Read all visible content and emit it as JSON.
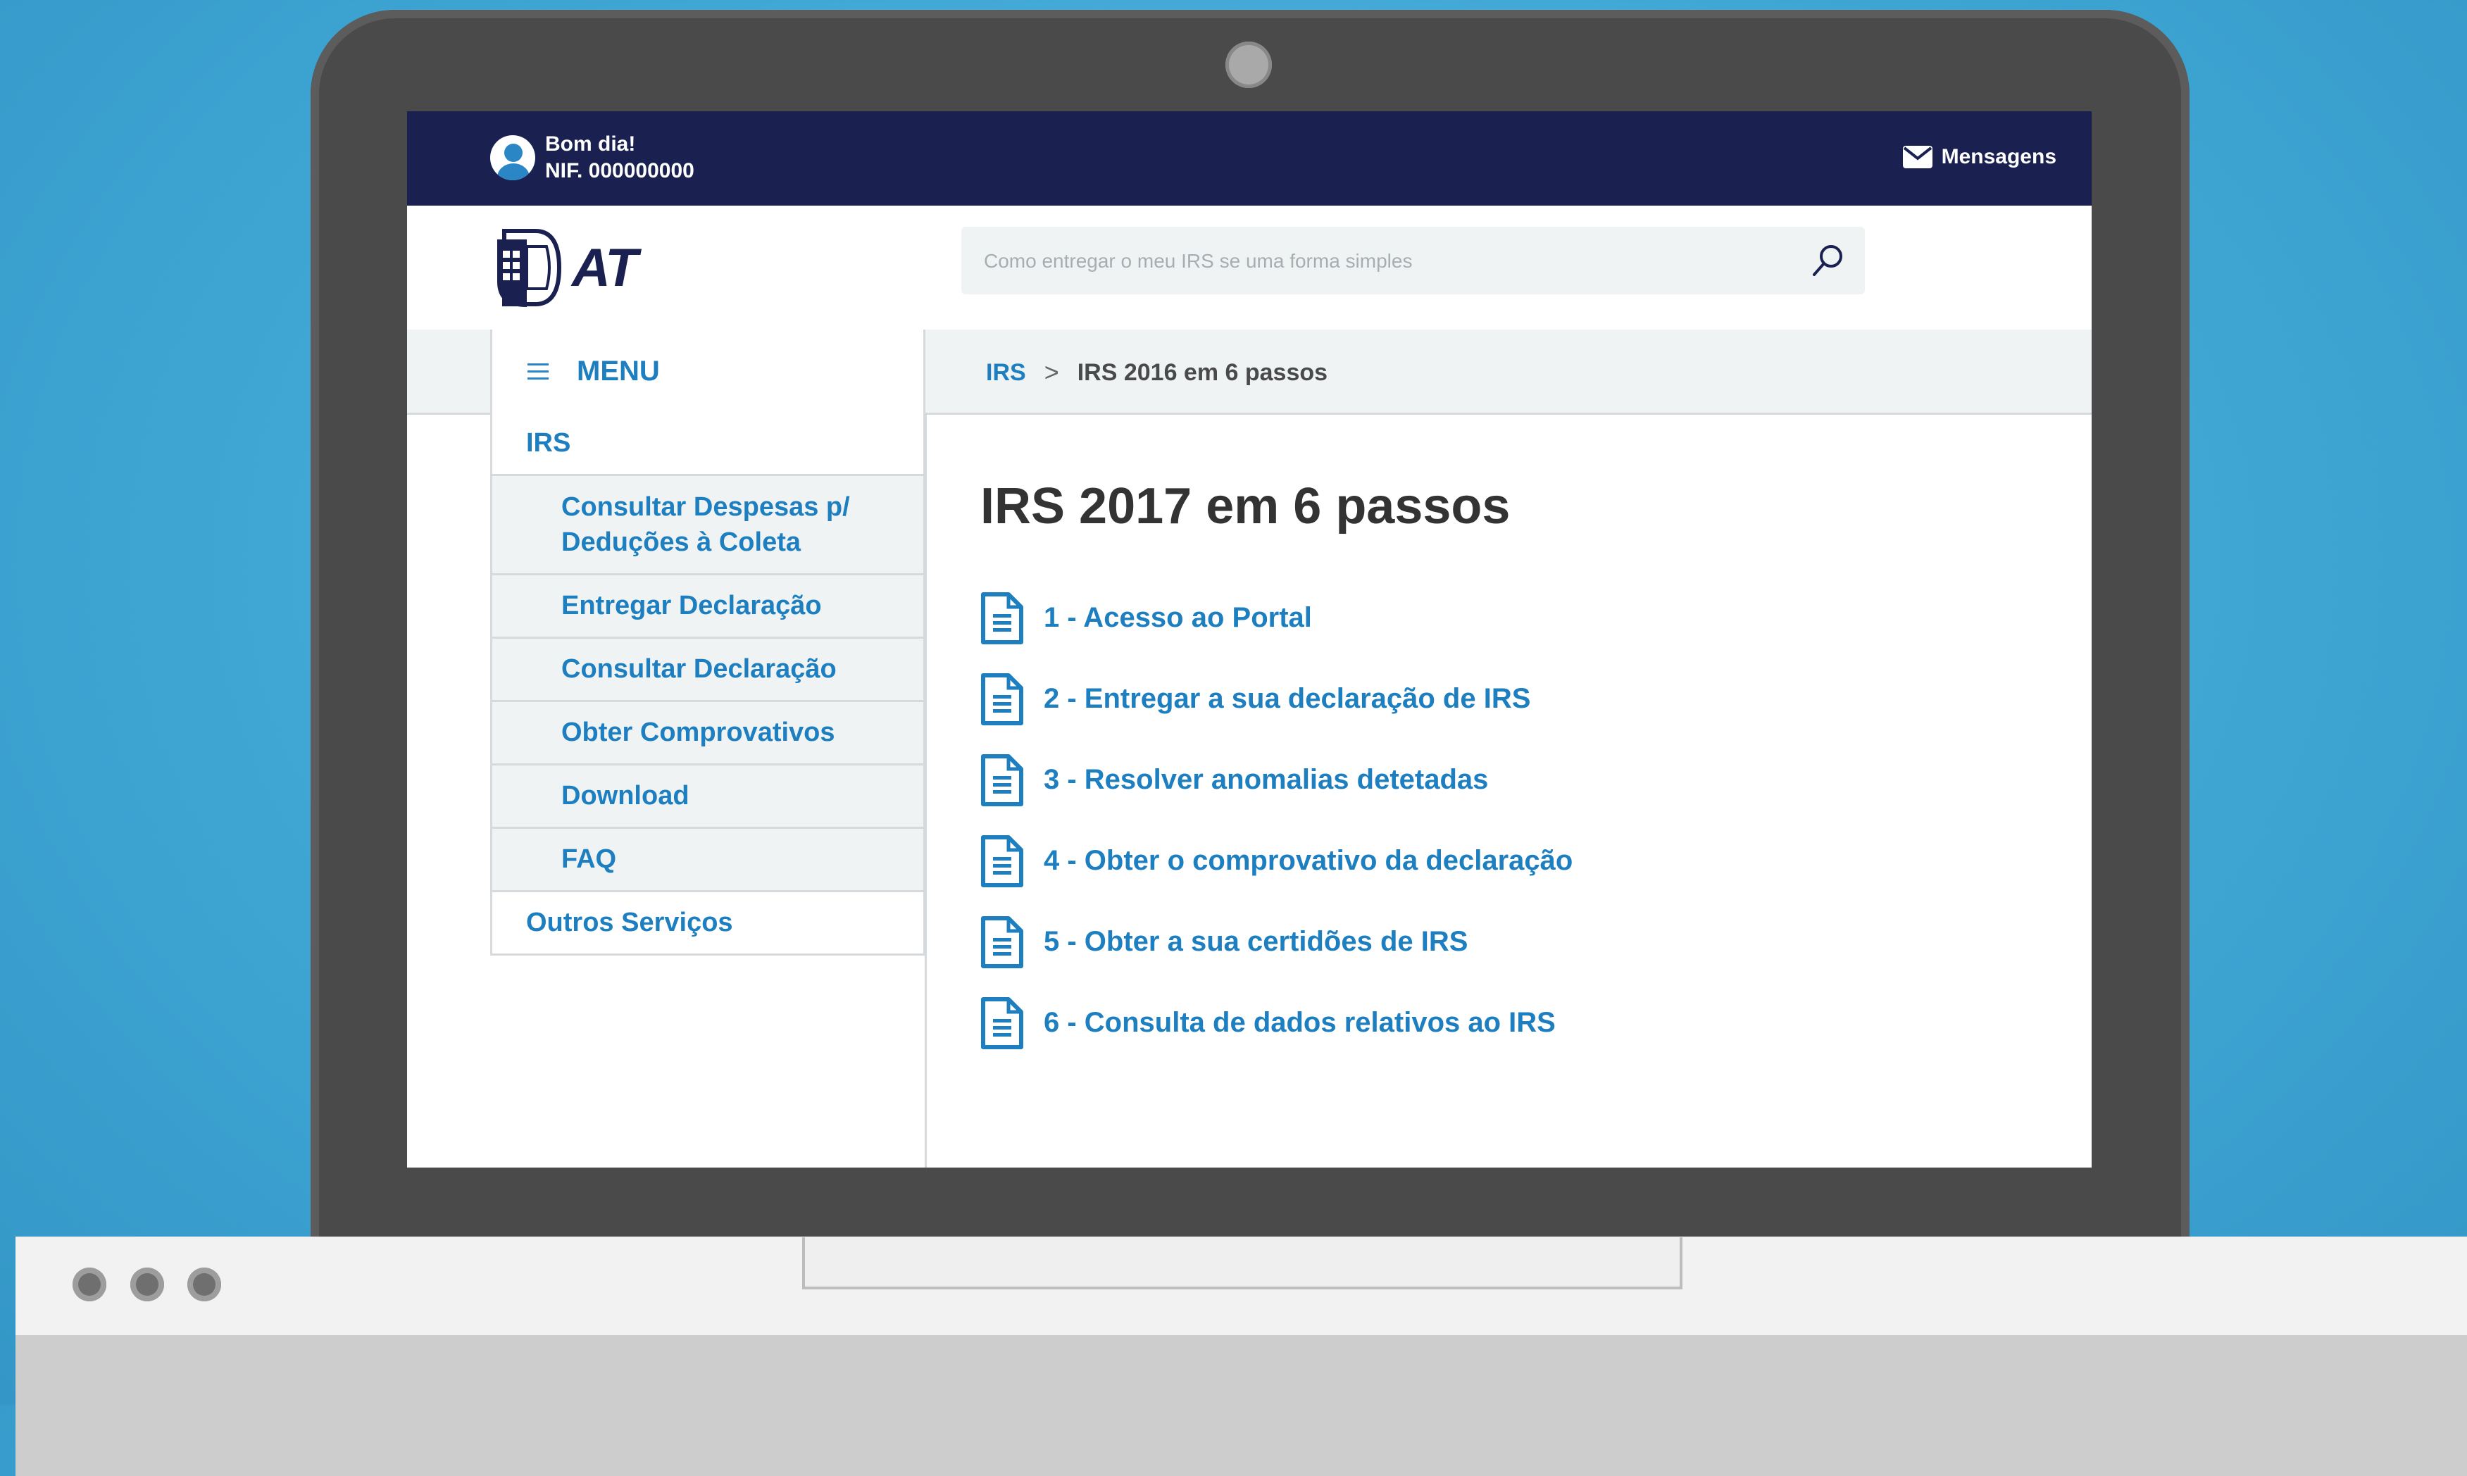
{
  "header": {
    "greeting": "Bom dia!",
    "nif": "NIF. 000000000",
    "messages_label": "Mensagens",
    "logo_text": "AT"
  },
  "search": {
    "placeholder": "Como entregar o meu IRS se uma forma simples"
  },
  "menu": {
    "label": "MENU"
  },
  "breadcrumb": {
    "items": [
      "IRS",
      "IRS 2016 em 6 passos"
    ],
    "separator": ">"
  },
  "sidebar": {
    "items": [
      {
        "label": "IRS",
        "level": "top"
      },
      {
        "label_line1": "Consultar Despesas p/",
        "label_line2": "Deduções à Coleta",
        "level": "sub"
      },
      {
        "label": "Entregar Declaração",
        "level": "sub"
      },
      {
        "label": "Consultar Declaração",
        "level": "sub"
      },
      {
        "label": "Obter Comprovativos",
        "level": "sub"
      },
      {
        "label": "Download",
        "level": "sub"
      },
      {
        "label": "FAQ",
        "level": "sub"
      },
      {
        "label": "Outros Serviços",
        "level": "top"
      }
    ]
  },
  "main": {
    "title": "IRS 2017 em 6 passos",
    "steps": [
      {
        "label": "1 - Acesso ao Portal",
        "icon": "document-icon"
      },
      {
        "label": "2 - Entregar a sua declaração de IRS",
        "icon": "document-icon"
      },
      {
        "label": "3 - Resolver anomalias detetadas",
        "icon": "document-icon"
      },
      {
        "label": "4 - Obter o comprovativo da declaração",
        "icon": "document-icon"
      },
      {
        "label": "5 - Obter a sua certidões de IRS",
        "icon": "document-icon"
      },
      {
        "label": "6 - Consulta de dados relativos ao IRS",
        "icon": "document-icon"
      }
    ]
  },
  "colors": {
    "topbar": "#1a2151",
    "link": "#1d7fc0",
    "panel": "#f0f3f4",
    "background": "#3ea5d3"
  }
}
